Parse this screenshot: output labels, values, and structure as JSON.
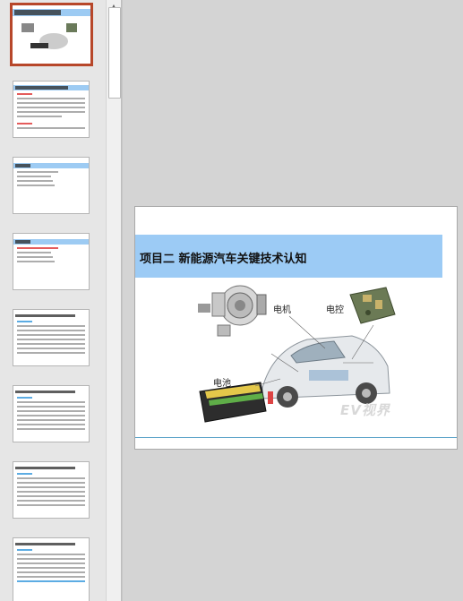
{
  "slide": {
    "title": "项目二  新能源汽车关键技术认知",
    "labels": {
      "motor": "电机",
      "controller": "电控",
      "battery": "电池"
    },
    "watermark": "EV视界"
  },
  "thumbnails": [
    {
      "selected": true
    },
    {
      "selected": false
    },
    {
      "selected": false
    },
    {
      "selected": false
    },
    {
      "selected": false
    },
    {
      "selected": false
    },
    {
      "selected": false
    },
    {
      "selected": false
    }
  ],
  "colors": {
    "accent": "#9ccbf5",
    "selection": "#b7472a",
    "rule": "#5aa2c8"
  },
  "icons": {
    "scroll_up": "up-arrow-icon"
  }
}
